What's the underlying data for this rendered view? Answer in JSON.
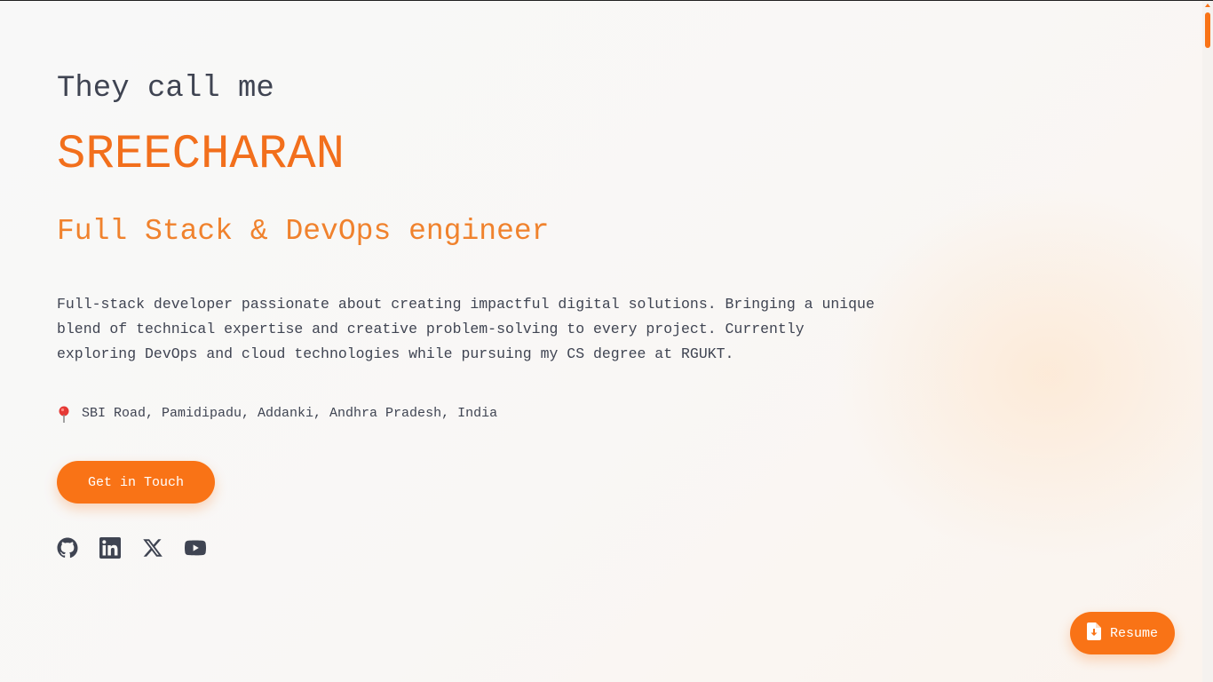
{
  "hero": {
    "intro": "They call me",
    "name": "SREECHARAN",
    "role": "Full Stack & DevOps engineer",
    "bio_lines": [
      "Full-stack developer passionate about creating impactful digital solutions. Bringing a unique",
      "blend of technical expertise and creative problem-solving to every project. Currently",
      "exploring DevOps and cloud technologies while pursuing my CS degree at RGUKT."
    ],
    "location": "SBI Road, Pamidipadu, Addanki, Andhra Pradesh, India",
    "location_icon": "map-pin-icon",
    "cta_label": "Get in Touch"
  },
  "socials": [
    {
      "icon": "github-icon"
    },
    {
      "icon": "linkedin-icon"
    },
    {
      "icon": "x-twitter-icon"
    },
    {
      "icon": "youtube-icon"
    }
  ],
  "resume": {
    "label": "Resume",
    "icon": "file-download-icon"
  },
  "colors": {
    "accent": "#f97316",
    "name": "#f26f1c",
    "text": "#3f4452"
  }
}
